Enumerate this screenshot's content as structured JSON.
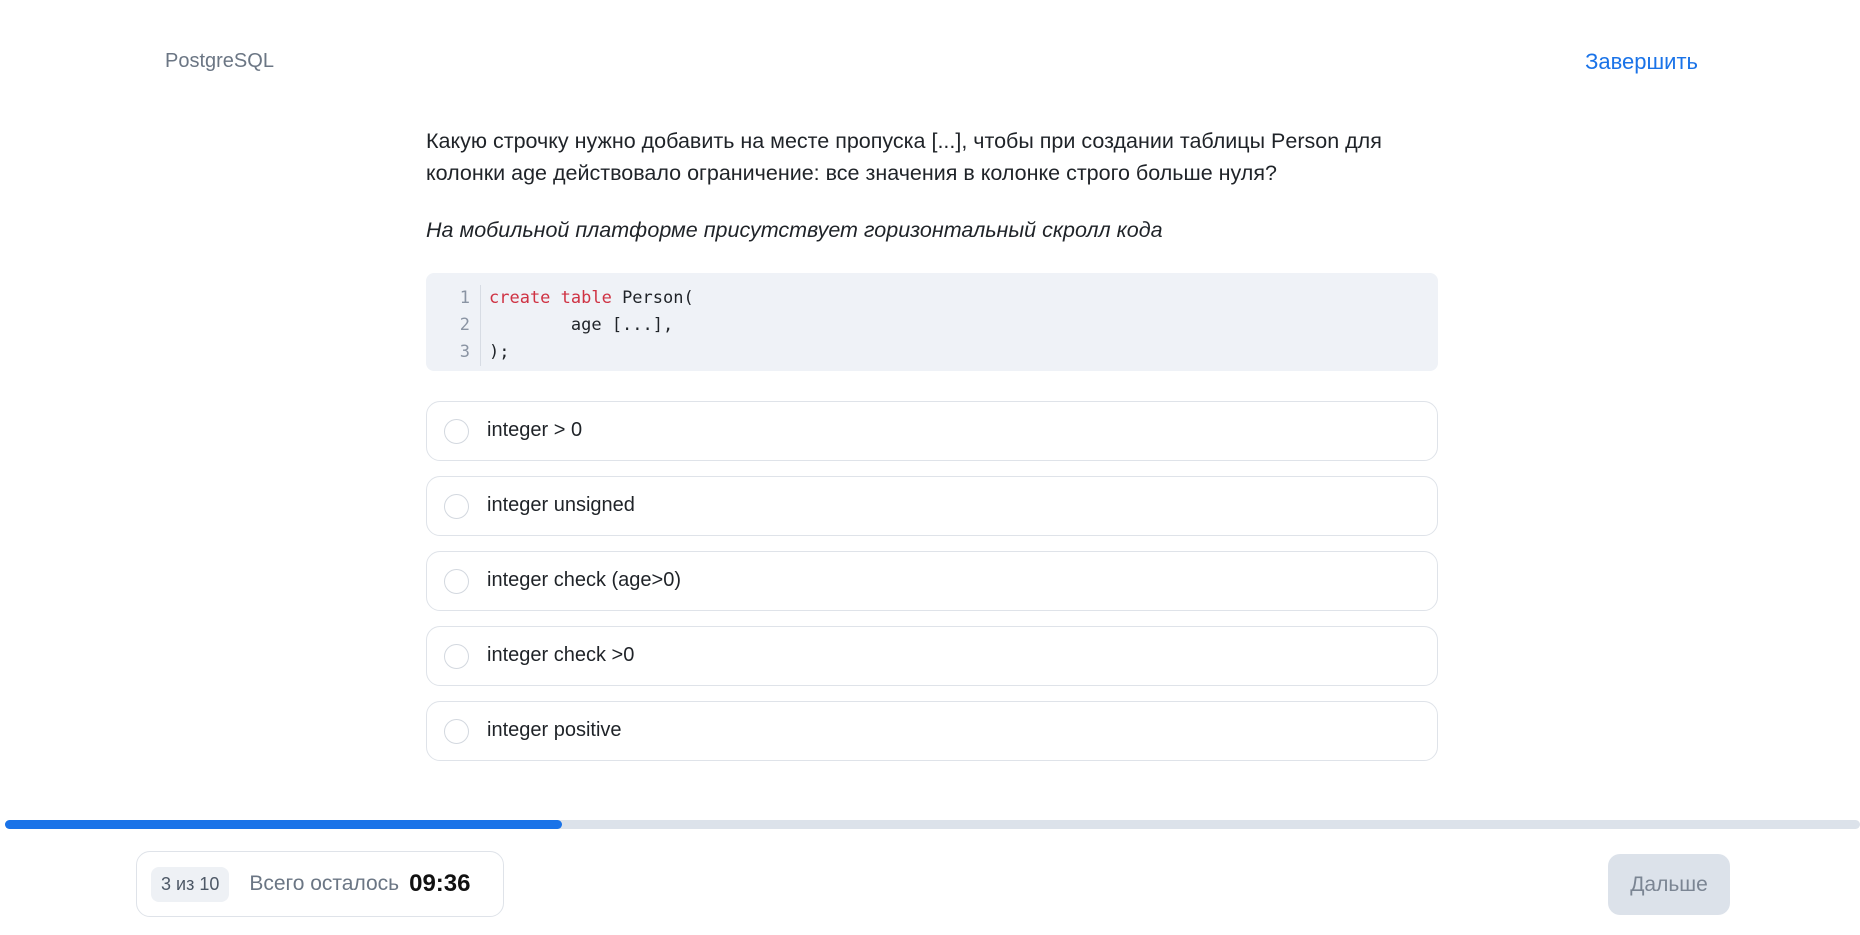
{
  "header": {
    "brand": "PostgreSQL",
    "finish_label": "Завершить"
  },
  "question": {
    "text": "Какую строчку нужно добавить на месте пропуска [...], чтобы при создании таблицы Person для колонки age действовало ограничение: все значения в колонке строго больше нуля?",
    "hint": "На мобильной платформе присутствует горизонтальный скролл кода"
  },
  "code": {
    "lines": [
      {
        "number": "1",
        "keyword": "create table",
        "rest": " Person("
      },
      {
        "number": "2",
        "keyword": "",
        "rest": "        age [...],"
      },
      {
        "number": "3",
        "keyword": "",
        "rest": ");"
      }
    ]
  },
  "options": [
    {
      "label": "integer > 0"
    },
    {
      "label": "integer unsigned"
    },
    {
      "label": "integer check (age>0)"
    },
    {
      "label": "integer check >0"
    },
    {
      "label": "integer positive"
    }
  ],
  "progress": {
    "fraction": 0.3,
    "colors": {
      "fill": "#1a73e8",
      "track": "#dce2ea"
    }
  },
  "footer": {
    "step": "3 из 10",
    "remaining_label": "Всего осталось",
    "timer": "09:36",
    "next_label": "Дальше"
  }
}
